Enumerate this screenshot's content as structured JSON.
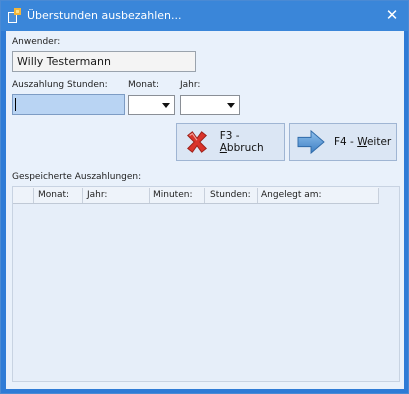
{
  "window": {
    "title": "Überstunden ausbezahlen...",
    "close_glyph": "✕",
    "accent_color": "#3a86d9"
  },
  "form": {
    "user_label": "Anwender:",
    "user_value": "Willy Testermann",
    "hours_label": "Auszahlung Stunden:",
    "hours_value": "",
    "month_label": "Monat:",
    "month_value": "",
    "year_label": "Jahr:",
    "year_value": ""
  },
  "buttons": {
    "cancel_label": "F3 - Abbruch",
    "cancel_icon": "red-x-icon",
    "next_label": "F4 - Weiter",
    "next_icon": "blue-arrow-right-icon"
  },
  "saved": {
    "label": "Gespeicherte Auszahlungen:",
    "columns": [
      "Monat:",
      "Jahr:",
      "Minuten:",
      "Stunden:",
      "Angelegt am:"
    ],
    "rows": []
  }
}
